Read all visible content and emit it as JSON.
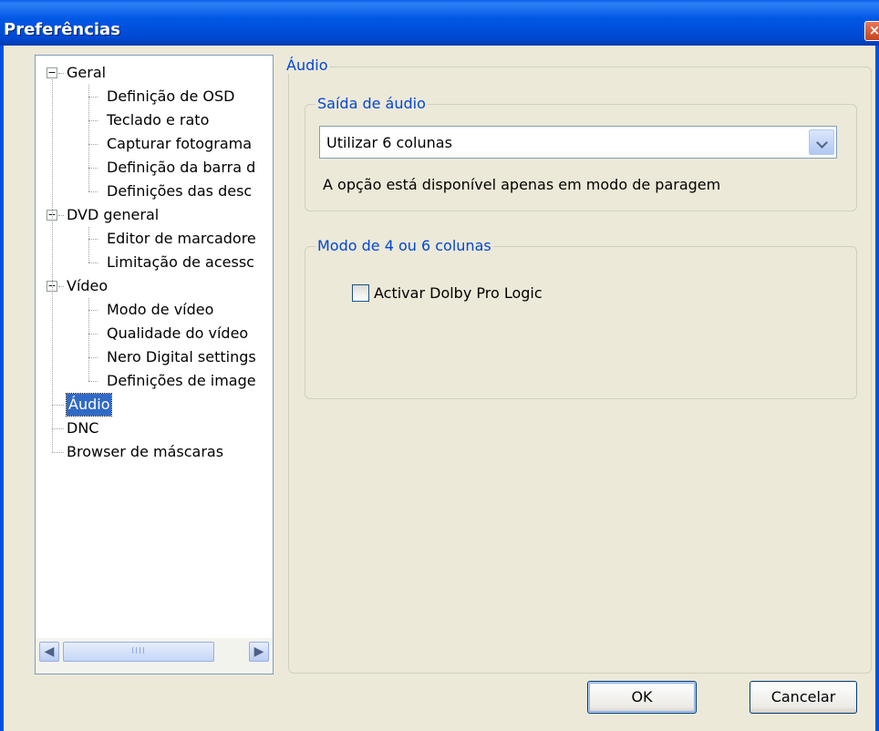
{
  "window": {
    "title": "Preferências",
    "close_glyph": "×"
  },
  "tree": {
    "items": [
      {
        "label": "Geral",
        "name": "tree-item-geral",
        "level": 0,
        "expander": "−"
      },
      {
        "label": "Definição de OSD",
        "name": "tree-item-definicao-osd",
        "level": 1
      },
      {
        "label": "Teclado e rato",
        "name": "tree-item-teclado-rato",
        "level": 1
      },
      {
        "label": "Capturar fotograma",
        "name": "tree-item-capturar-fotograma",
        "level": 1
      },
      {
        "label": "Definição da barra d",
        "name": "tree-item-definicao-barra",
        "level": 1
      },
      {
        "label": "Definições das desc",
        "name": "tree-item-definicoes-desc",
        "level": 1
      },
      {
        "label": "DVD general",
        "name": "tree-item-dvd-general",
        "level": 0,
        "expander": "−"
      },
      {
        "label": "Editor de marcadore",
        "name": "tree-item-editor-marcadores",
        "level": 1
      },
      {
        "label": "Limitação de acessc",
        "name": "tree-item-limitacao-acesso",
        "level": 1
      },
      {
        "label": "Vídeo",
        "name": "tree-item-video",
        "level": 0,
        "expander": "−"
      },
      {
        "label": "Modo de vídeo",
        "name": "tree-item-modo-video",
        "level": 1
      },
      {
        "label": "Qualidade do vídeo",
        "name": "tree-item-qualidade-video",
        "level": 1
      },
      {
        "label": "Nero Digital settings",
        "name": "tree-item-nero-digital",
        "level": 1
      },
      {
        "label": "Definições de image",
        "name": "tree-item-definicoes-imagem",
        "level": 1
      },
      {
        "label": "Áudio",
        "name": "tree-item-audio",
        "level": 0,
        "selected": true
      },
      {
        "label": "DNC",
        "name": "tree-item-dnc",
        "level": 0
      },
      {
        "label": "Browser de máscaras",
        "name": "tree-item-browser-mascaras",
        "level": 0
      }
    ],
    "scrollbar": {
      "left_glyph": "◀",
      "right_glyph": "▶",
      "grip": "IIII"
    }
  },
  "panel": {
    "title": "Áudio",
    "output_group": {
      "title": "Saída de áudio",
      "select_value": "Utilizar 6 colunas",
      "note": "A opção está disponível apenas em modo de paragem"
    },
    "mode_group": {
      "title": "Modo de 4 ou 6 colunas",
      "checkbox_label": "Activar Dolby Pro Logic",
      "checkbox_checked": false
    }
  },
  "buttons": {
    "ok": "OK",
    "cancel": "Cancelar"
  },
  "colors": {
    "titlebar": "#0058e6",
    "group_title": "#0046d5",
    "selection": "#316ac5",
    "face": "#ece9d8"
  }
}
